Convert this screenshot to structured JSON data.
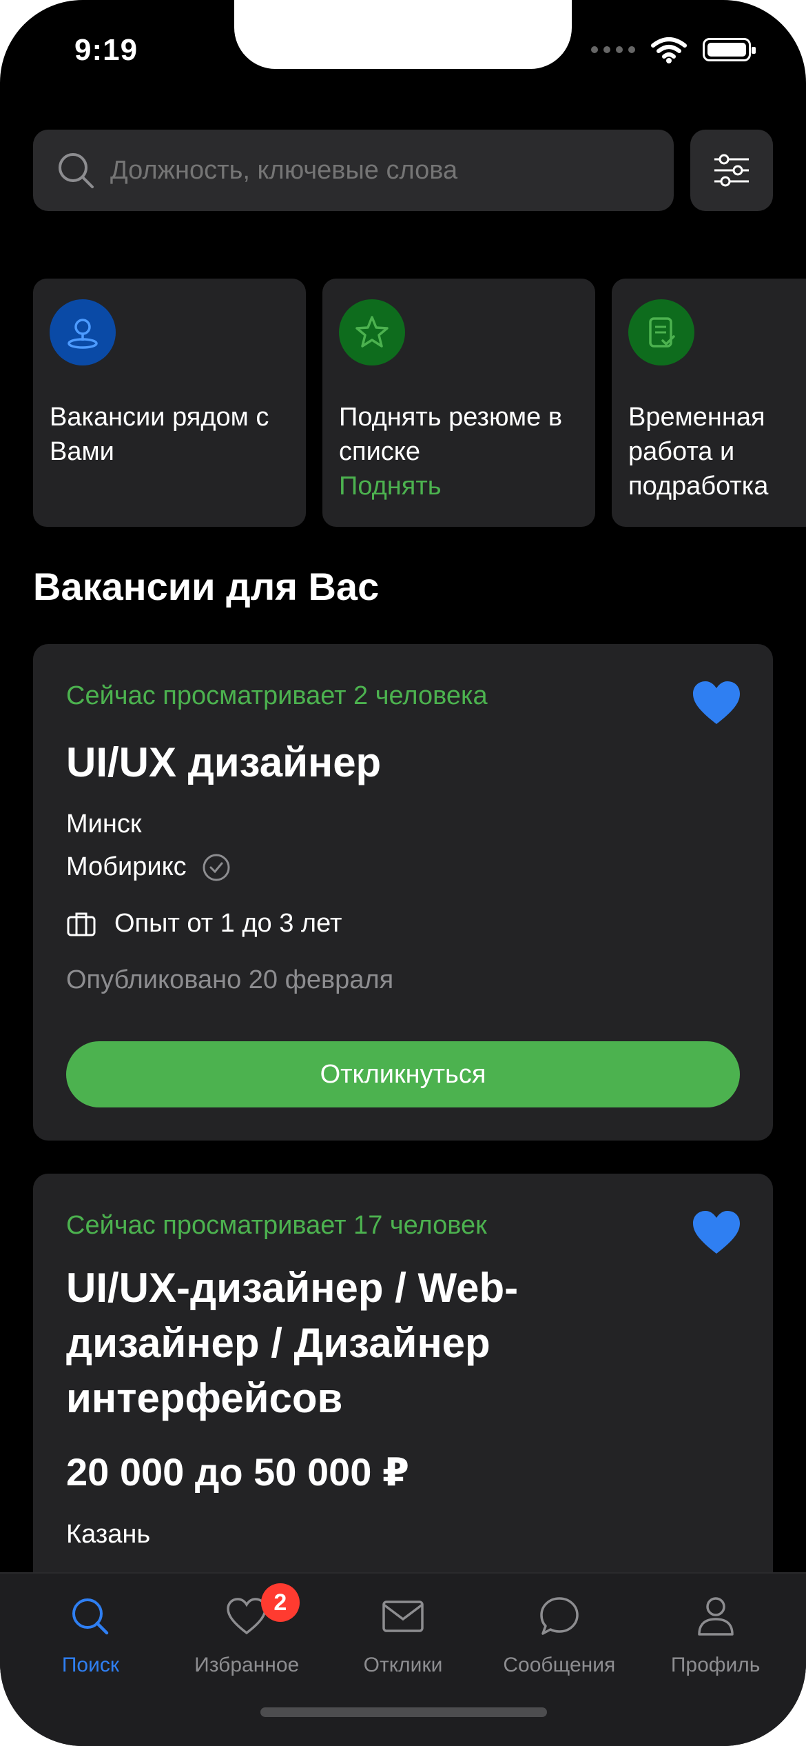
{
  "status_bar": {
    "time": "9:19"
  },
  "search": {
    "placeholder": "Должность, ключевые слова"
  },
  "quick_actions": [
    {
      "title": "Вакансии рядом с Вами",
      "action": "",
      "icon": "location-pin-icon",
      "color": "#0a4aa6"
    },
    {
      "title": "Поднять резюме в списке",
      "action": "Поднять",
      "icon": "star-icon",
      "color": "#0e6c1d"
    },
    {
      "title": "Временная работа и подработка",
      "action": "",
      "icon": "document-check-icon",
      "color": "#0e6c1d"
    }
  ],
  "section_title": "Вакансии для Вас",
  "vacancies": [
    {
      "viewing": "Сейчас просматривает 2 человека",
      "title": "UI/UX дизайнер",
      "salary": "",
      "city": "Минск",
      "company": "Мобирикс",
      "experience": "Опыт от 1 до 3 лет",
      "published": "Опубликовано 20 февраля",
      "apply_label": "Откликнуться"
    },
    {
      "viewing": "Сейчас просматривает 17 человек",
      "title_lines": [
        "UI/UX-дизайнер / Web-",
        "дизайнер / Дизайнер",
        "интерфейсов"
      ],
      "salary": "20 000 до 50 000 ₽",
      "city": "Казань"
    }
  ],
  "tabbar": {
    "tabs": [
      {
        "label": "Поиск",
        "icon": "search-icon",
        "active": true
      },
      {
        "label": "Избранное",
        "icon": "heart-icon",
        "badge": "2"
      },
      {
        "label": "Отклики",
        "icon": "envelope-icon"
      },
      {
        "label": "Сообщения",
        "icon": "chat-bubble-icon"
      },
      {
        "label": "Профиль",
        "icon": "person-icon"
      }
    ]
  },
  "colors": {
    "accent_green": "#4cb24f",
    "accent_blue": "#2f7ff2",
    "card": "#232325",
    "badge_red": "#ff3b30"
  }
}
